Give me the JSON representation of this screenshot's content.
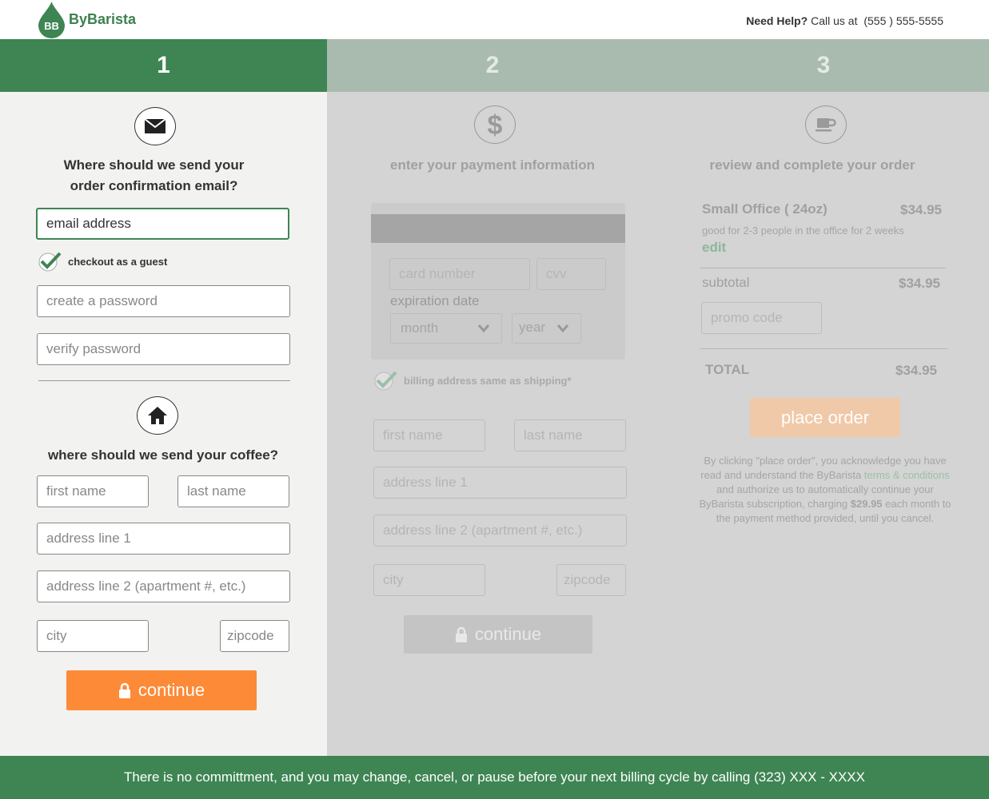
{
  "header": {
    "logo_mark": "BB",
    "brand": "ByBarista",
    "help_label": "Need Help?",
    "help_text": "Call us at",
    "phone": "(555 ) 555-5555"
  },
  "steps": [
    "1",
    "2",
    "3"
  ],
  "step1": {
    "email_heading_line1": "Where should we send your",
    "email_heading_line2": "order confirmation email?",
    "email_placeholder": "email address",
    "guest_label": "checkout as a guest",
    "password_placeholder": "create a password",
    "verify_placeholder": "verify password",
    "shipping_heading": "where should we send your coffee?",
    "first_name": "first name",
    "last_name": "last name",
    "address1": "address line 1",
    "address2": "address line 2 (apartment #, etc.)",
    "city": "city",
    "zipcode": "zipcode",
    "continue_label": "continue"
  },
  "step2": {
    "heading": "enter your payment information",
    "card_number": "card number",
    "cvv": "cvv",
    "expiration_label": "expiration date",
    "month": "month",
    "year": "year",
    "billing_same_label": "billing address same as shipping",
    "billing_same_mark": "*",
    "first_name": "first name",
    "last_name": "last name",
    "address1": "address line 1",
    "address2": "address line 2 (apartment #, etc.)",
    "city": "city",
    "zipcode": "zipcode",
    "continue_label": "continue"
  },
  "step3": {
    "heading": "review and complete your order",
    "product_name": "Small Office ( 24oz)",
    "product_price": "$34.95",
    "product_desc": "good for 2-3 people in the office for 2 weeks",
    "edit_label": "edit",
    "subtotal_label": "subtotal",
    "subtotal_value": "$34.95",
    "promo_placeholder": "promo code",
    "total_label": "TOTAL",
    "total_value": "$34.95",
    "place_order_label": "place order",
    "legal_1": "By clicking \"place order\", you acknowledge you have read and understand the ByBarista ",
    "legal_link": "terms & conditions",
    "legal_2": " and authorize us to automatically continue your ByBarista subscription, charging ",
    "legal_amount": "$29.95",
    "legal_3": " each month to the payment method provided, until you cancel."
  },
  "footer": {
    "text": "There is no committment, and you may change, cancel, or pause before your next billing cycle by calling (323) XXX - XXXX"
  },
  "colors": {
    "brand_green": "#3e8553",
    "step_inactive": "#a9bbaf",
    "accent_orange": "#fd8a36"
  }
}
